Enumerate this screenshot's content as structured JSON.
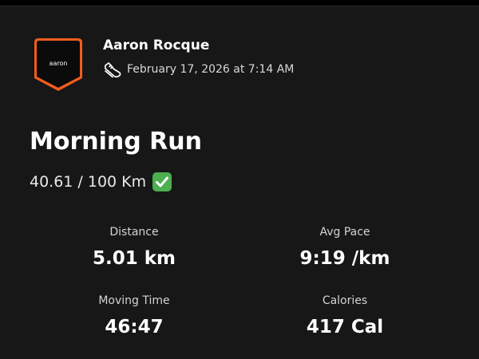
{
  "colors": {
    "background": "#171717",
    "text_primary": "#ffffff",
    "text_secondary": "#d8d8d8",
    "badge_border": "#fc5200",
    "badge_fill": "#000000",
    "check_green": "#4caf50"
  },
  "athlete": {
    "name": "Aaron Rocque",
    "avatar_text": "aaron",
    "activity_icon": "running-shoe-icon"
  },
  "activity": {
    "date": "February 17, 2026 at 7:14 AM",
    "title": "Morning Run",
    "goal_progress": "40.61 / 100 Km",
    "goal_icon": "check-mark-icon"
  },
  "stats": [
    {
      "label": "Distance",
      "value": "5.01 km"
    },
    {
      "label": "Avg Pace",
      "value": "9:19 /km"
    },
    {
      "label": "Moving Time",
      "value": "46:47"
    },
    {
      "label": "Calories",
      "value": "417 Cal"
    }
  ]
}
